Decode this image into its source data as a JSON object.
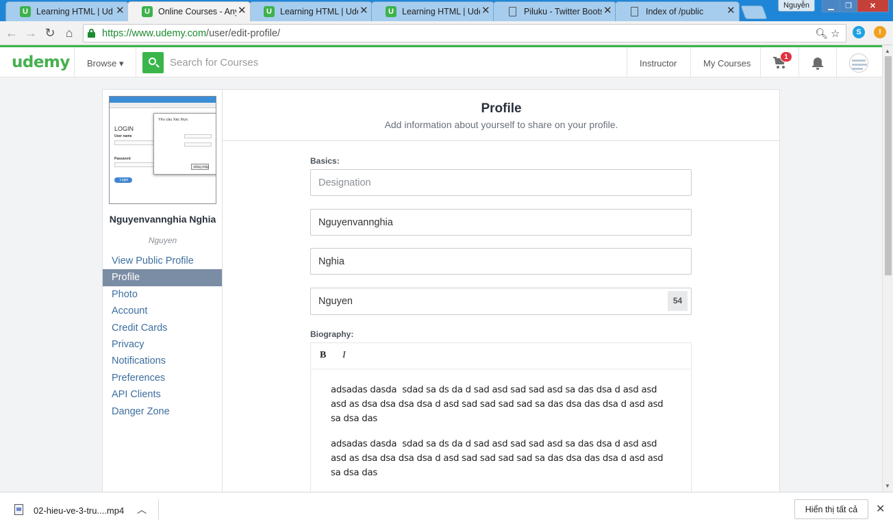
{
  "browser": {
    "tabs": [
      {
        "title": "Learning HTML | Uden",
        "icon": "udemy-favicon",
        "active": false
      },
      {
        "title": "Online Courses - Anyti",
        "icon": "udemy-favicon",
        "active": true
      },
      {
        "title": "Learning HTML | Uden",
        "icon": "udemy-favicon",
        "active": false
      },
      {
        "title": "Learning HTML | Uden",
        "icon": "udemy-favicon",
        "active": false
      },
      {
        "title": "Piluku - Twitter Bootst",
        "icon": "document-icon",
        "active": false
      },
      {
        "title": "Index of /public",
        "icon": "document-icon",
        "active": false
      }
    ],
    "tab_favicon_letter": "U",
    "close_glyph": "✕",
    "profile_name": "Nguyễn",
    "url_scheme": "https://",
    "url_host": "www.udemy.com",
    "url_path": "/user/edit-profile/",
    "colors": {
      "tabstrip": "#1f86d7",
      "secure_green": "#1c8a2e"
    }
  },
  "header": {
    "logo": "udemy",
    "browse_label": "Browse ▾",
    "search_placeholder": "Search for Courses",
    "instructor_label": "Instructor",
    "my_courses_label": "My Courses",
    "cart_count": "1",
    "colors": {
      "brand": "#46b04f",
      "badge": "#e2323f"
    }
  },
  "sidebar": {
    "user_name": "Nguyenvannghia Nghia",
    "user_subtitle": "Nguyen",
    "items": [
      {
        "label": "View Public Profile",
        "active": false
      },
      {
        "label": "Profile",
        "active": true
      },
      {
        "label": "Photo",
        "active": false
      },
      {
        "label": "Account",
        "active": false
      },
      {
        "label": "Credit Cards",
        "active": false
      },
      {
        "label": "Privacy",
        "active": false
      },
      {
        "label": "Notifications",
        "active": false
      },
      {
        "label": "Preferences",
        "active": false
      },
      {
        "label": "API Clients",
        "active": false
      },
      {
        "label": "Danger Zone",
        "active": false
      }
    ],
    "thumbnail": {
      "login_heading": "LOGIN",
      "user_name_label": "User name",
      "password_label": "Password",
      "dialog_title": "Yêu cầu Xác thực",
      "dialog_button": "Đăng nhập",
      "login_button": "Login"
    }
  },
  "main": {
    "title": "Profile",
    "subtitle": "Add information about yourself to share on your profile.",
    "basics_label": "Basics:",
    "designation_placeholder": "Designation",
    "first_name": "Nguyenvannghia",
    "last_name": "Nghia",
    "headline": "Nguyen",
    "headline_counter": "54",
    "biography_label": "Biography:",
    "bold_button": "B",
    "italic_button": "I",
    "biography_paragraphs": [
      "adsadas dasda  sdad sa ds da d sad asd sad sad asd sa das dsa d asd asd asd as dsa dsa dsa dsa d asd sad sad sad sad sa das dsa das dsa d asd asd sa dsa das",
      "adsadas dasda  sdad sa ds da d sad asd sad sad asd sa das dsa d asd asd asd as dsa dsa dsa dsa d asd sad sad sad sad sa das dsa das dsa d asd asd sa dsa das"
    ]
  },
  "download_bar": {
    "file_name": "02-hieu-ve-3-tru....mp4",
    "show_all_label": "Hiển thị tất cả"
  }
}
